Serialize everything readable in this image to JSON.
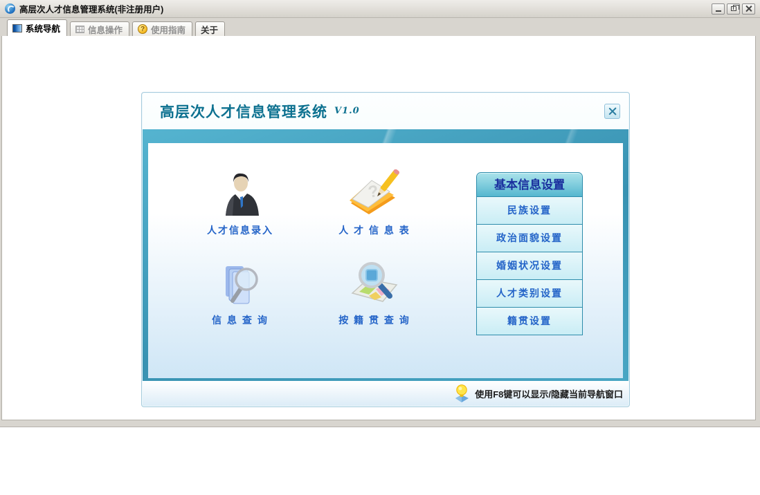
{
  "window": {
    "title": "高层次人才信息管理系统(非注册用户)"
  },
  "tabs": [
    {
      "label": "系统导航",
      "icon": "navigation-icon",
      "state": "active"
    },
    {
      "label": "信息操作",
      "icon": "grid-icon",
      "state": "inactive"
    },
    {
      "label": "使用指南",
      "icon": "help-icon",
      "state": "inactive"
    },
    {
      "label": "关于",
      "icon": "none",
      "state": "inactive"
    }
  ],
  "dialog": {
    "title": "高层次人才信息管理系统",
    "version": "V1.0",
    "shortcuts": [
      {
        "label": "人才信息录入",
        "icon": "person-entry-icon"
      },
      {
        "label": "人 才 信 息 表",
        "icon": "notepad-pencil-icon"
      },
      {
        "label": "信 息 查 询",
        "icon": "folders-search-icon"
      },
      {
        "label": "按 籍 贯 查 询",
        "icon": "map-search-icon"
      }
    ],
    "settings": {
      "header": "基本信息设置",
      "items": [
        {
          "label": "民族设置"
        },
        {
          "label": "政治面貌设置"
        },
        {
          "label": "婚姻状况设置"
        },
        {
          "label": "人才类别设置"
        },
        {
          "label": "籍贯设置"
        }
      ]
    },
    "footer_tip": "使用F8键可以显示/隐藏当前导航窗口"
  },
  "colors": {
    "teal_band": "#3f9fbe",
    "dialog_title_text": "#0d7190",
    "shortcut_label_blue": "#2464c8",
    "settings_header_text": "#1a2f9e",
    "titlebar_gray": "#d8d5cf"
  }
}
